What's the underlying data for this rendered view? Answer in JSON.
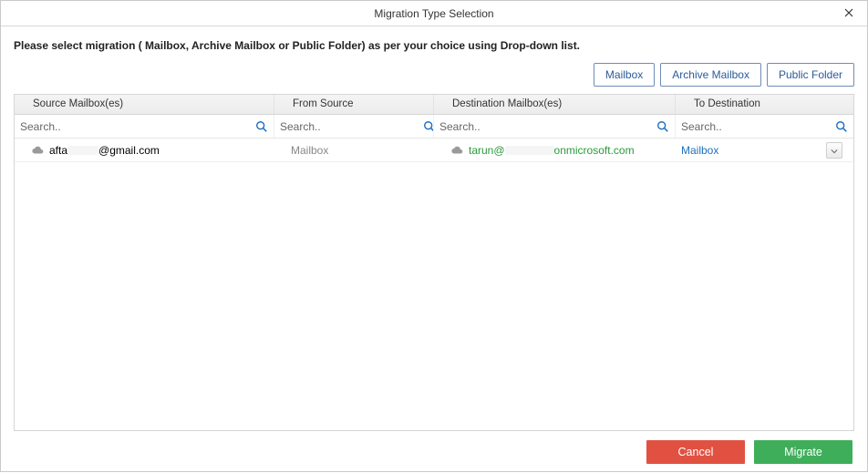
{
  "window": {
    "title": "Migration Type Selection"
  },
  "instruction": "Please select migration ( Mailbox, Archive Mailbox or Public Folder) as per your choice using Drop-down list.",
  "typeButtons": {
    "mailbox": "Mailbox",
    "archive": "Archive Mailbox",
    "public": "Public Folder"
  },
  "columns": {
    "source": "Source Mailbox(es)",
    "from": "From Source",
    "dest": "Destination Mailbox(es)",
    "to": "To Destination"
  },
  "search": {
    "placeholder": "Search.."
  },
  "rows": [
    {
      "source_prefix": "afta",
      "source_suffix": "@gmail.com",
      "from": "Mailbox",
      "dest_prefix": "tarun@",
      "dest_suffix": "onmicrosoft.com",
      "to": "Mailbox"
    }
  ],
  "footer": {
    "cancel": "Cancel",
    "migrate": "Migrate"
  }
}
